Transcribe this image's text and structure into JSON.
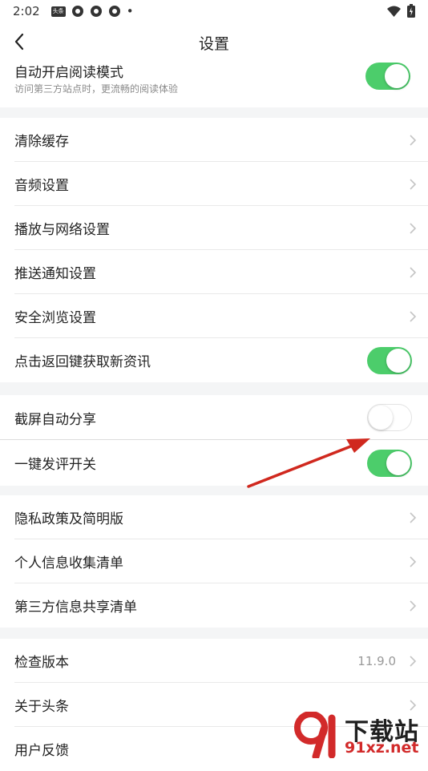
{
  "status_bar": {
    "time": "2:02",
    "badge": "头条",
    "icons": [
      "app-icon",
      "app-icon",
      "app-icon"
    ],
    "dot": "•"
  },
  "header": {
    "title": "设置"
  },
  "reading_mode": {
    "title": "自动开启阅读模式",
    "subtitle": "访问第三方站点时，更流畅的阅读体验",
    "enabled": true
  },
  "group1": [
    {
      "label": "清除缓存"
    },
    {
      "label": "音频设置"
    },
    {
      "label": "播放与网络设置"
    },
    {
      "label": "推送通知设置"
    },
    {
      "label": "安全浏览设置"
    },
    {
      "label": "点击返回键获取新资讯",
      "toggle": true
    }
  ],
  "group2": [
    {
      "label": "截屏自动分享",
      "toggle": false
    },
    {
      "label": "一键发评开关",
      "toggle": true
    }
  ],
  "group3": [
    {
      "label": "隐私政策及简明版"
    },
    {
      "label": "个人信息收集清单"
    },
    {
      "label": "第三方信息共享清单"
    }
  ],
  "group4": [
    {
      "label": "检查版本",
      "value": "11.9.0"
    },
    {
      "label": "关于头条"
    },
    {
      "label": "用户反馈"
    }
  ],
  "watermark": {
    "big": "下载站",
    "small": "91xz.net"
  },
  "colors": {
    "toggle_on": "#4ccd6b",
    "annotation_arrow": "#d0281e",
    "watermark_red": "#d22a2a"
  }
}
